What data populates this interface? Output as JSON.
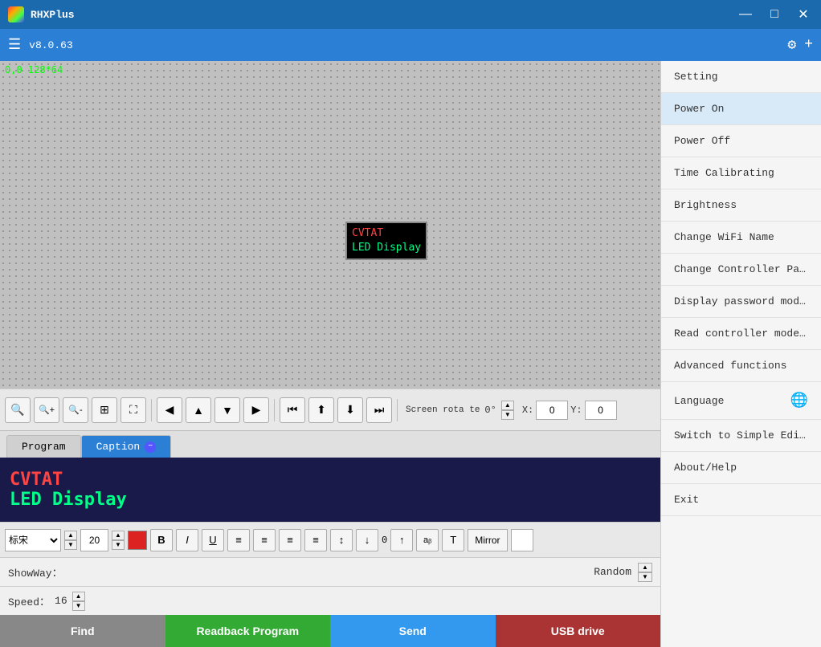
{
  "titlebar": {
    "logo_alt": "RHXPlus logo",
    "title": "RHXPlus",
    "min_label": "—",
    "max_label": "□",
    "close_label": "✕"
  },
  "toolbar": {
    "hamburger_label": "☰",
    "version": "v8.0.63",
    "settings_label": "⚙",
    "add_label": "+"
  },
  "canvas": {
    "coord": "0,0  128*64",
    "led_line1": "CVTAT",
    "led_line2": "LED Display"
  },
  "controls": {
    "zoom_in_label": "🔍",
    "zoom_in_plus_label": "🔍",
    "zoom_out_label": "🔍",
    "grid_label": "⊞",
    "fit_label": "⛶",
    "left_label": "◀",
    "up_label": "▲",
    "down_label": "▼",
    "right_label": "▶",
    "prev_label": "⏮",
    "scroll_up_label": "⬆",
    "scroll_down_label": "⬇",
    "scroll_right_label": "⏭",
    "screen_rotate": "Screen rota te",
    "rotate_value": "0°",
    "x_label": "X:",
    "x_value": "0",
    "y_label": "Y:",
    "y_value": "0"
  },
  "tabs": {
    "program_label": "Program",
    "caption_label": "Caption"
  },
  "preview": {
    "line1": "CVTAT",
    "line2": "LED Display"
  },
  "format": {
    "font": "标宋",
    "size": "20",
    "bold_label": "B",
    "italic_label": "I",
    "underline_label": "U",
    "align_left": "≡",
    "align_center": "≡",
    "align_right": "≡",
    "align_full": "≡",
    "align_top": "⊤",
    "align_middle": "↕",
    "align_bottom": "⊥",
    "num_label": "0",
    "up_label": "↑",
    "font2_label": "aᵦ",
    "font3_label": "T",
    "mirror_label": "Mirror"
  },
  "showway": {
    "label": "ShowWay：",
    "value": "Random"
  },
  "speed": {
    "label": "Speed：",
    "value": "16"
  },
  "bottom_buttons": {
    "find": "Find",
    "readback": "Readback Program",
    "send": "Send",
    "usb": "USB drive"
  },
  "menu": {
    "items": [
      {
        "label": "Setting",
        "highlighted": false
      },
      {
        "label": "Power On",
        "highlighted": true
      },
      {
        "label": "Power Off",
        "highlighted": false
      },
      {
        "label": "Time Calibrating",
        "highlighted": false
      },
      {
        "label": "Brightness",
        "highlighted": false
      },
      {
        "label": "Change WiFi Name",
        "highlighted": false
      },
      {
        "label": "Change Controller Pas···",
        "highlighted": false
      },
      {
        "label": "Display password modi···",
        "highlighted": false
      },
      {
        "label": "Read controller model···",
        "highlighted": false
      },
      {
        "label": "Advanced functions",
        "highlighted": false
      },
      {
        "label": "Language",
        "highlighted": false,
        "has_globe": true
      },
      {
        "label": "Switch to Simple Edit···",
        "highlighted": false
      },
      {
        "label": "About/Help",
        "highlighted": false
      },
      {
        "label": "Exit",
        "highlighted": false
      }
    ]
  }
}
